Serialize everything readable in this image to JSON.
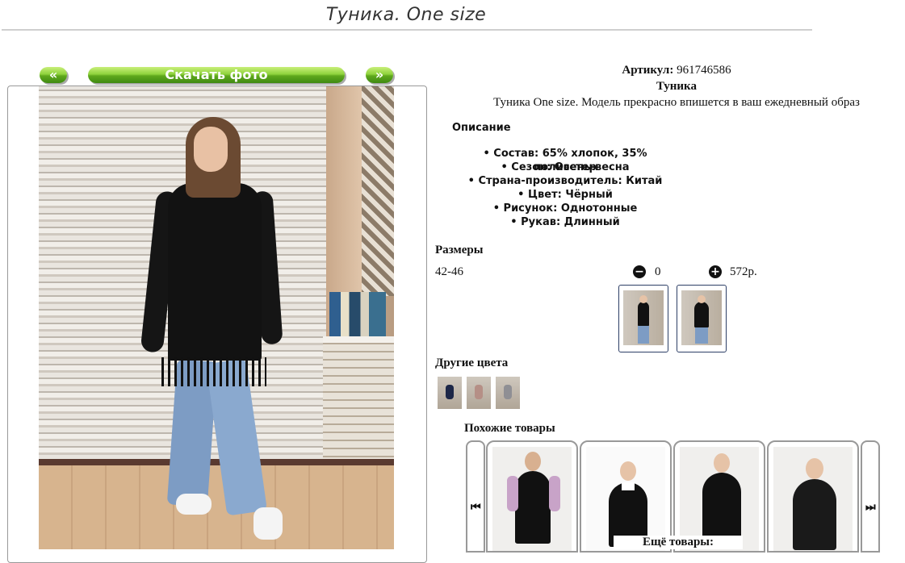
{
  "page_title": "Туника. One size",
  "photo_nav": {
    "prev_label": "«",
    "download_label": "Скачать фото",
    "next_label": "»"
  },
  "product": {
    "article_label": "Артикул:",
    "article_value": "961746586",
    "name": "Туника",
    "short_desc": "Туника One size. Модель прекрасно впишется в ваш ежедневный образ",
    "description_title": "Описание",
    "properties": [
      "Состав: 65% хлопок, 35% полиэстер",
      "Сезон: Осень-весна",
      "Страна-производитель: Китай",
      "Цвет: Чёрный",
      "Рисунок: Однотонные",
      "Рукав: Длинный"
    ]
  },
  "sizes": {
    "title": "Размеры",
    "rows": [
      {
        "size": "42-46",
        "quantity": "0",
        "price": "572р."
      }
    ],
    "minus_icon": "minus-circle-icon",
    "plus_icon": "plus-circle-icon"
  },
  "other_colors": {
    "title": "Другие цвета"
  },
  "similar": {
    "title": "Похожие товары",
    "prev_icon": "skip-back-icon",
    "next_icon": "skip-forward-icon",
    "more_label": "Ещё товары:"
  }
}
